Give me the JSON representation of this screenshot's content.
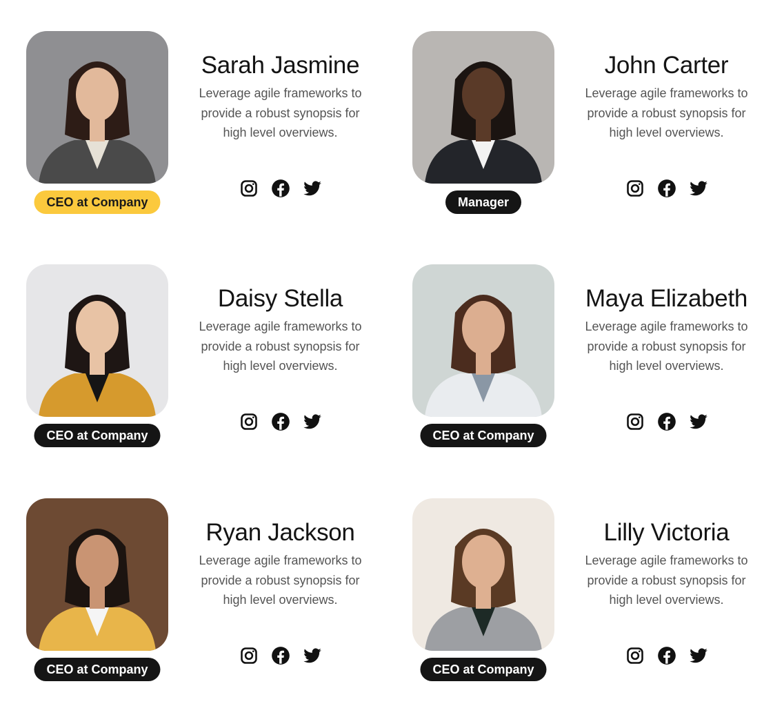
{
  "team": [
    {
      "name": "Sarah Jasmine",
      "role": "CEO at Company",
      "badge_style": "yellow",
      "desc": "Leverage agile frameworks to provide a robust synopsis for high level overviews.",
      "photo": {
        "bg": "#8f8f92",
        "skin": "#e2b99b",
        "hair": "#2d1c16",
        "outfit": "#4a4a4a",
        "shirt": "#e6e1d6"
      },
      "socials": [
        "instagram-icon",
        "facebook-icon",
        "twitter-icon"
      ]
    },
    {
      "name": "John Carter",
      "role": "Manager",
      "badge_style": "dark",
      "desc": "Leverage agile frameworks to provide a robust synopsis for high level overviews.",
      "photo": {
        "bg": "#b9b6b3",
        "skin": "#5a3a28",
        "hair": "#1b1411",
        "outfit": "#23252a",
        "shirt": "#f2f2f2"
      },
      "socials": [
        "instagram-icon",
        "facebook-icon",
        "twitter-icon"
      ]
    },
    {
      "name": "Daisy Stella",
      "role": "CEO at Company",
      "badge_style": "dark",
      "desc": "Leverage agile frameworks to provide a robust synopsis for high level overviews.",
      "photo": {
        "bg": "#e6e6e8",
        "skin": "#e8c3a5",
        "hair": "#1e1614",
        "outfit": "#d69a2d",
        "shirt": "#151515"
      },
      "socials": [
        "instagram-icon",
        "facebook-icon",
        "twitter-icon"
      ]
    },
    {
      "name": "Maya Elizabeth",
      "role": "CEO at Company",
      "badge_style": "dark",
      "desc": "Leverage agile frameworks to provide a robust synopsis for high level overviews.",
      "photo": {
        "bg": "#cfd6d4",
        "skin": "#dcae90",
        "hair": "#4b2c1e",
        "outfit": "#e9ecef",
        "shirt": "#8a97a5"
      },
      "socials": [
        "instagram-icon",
        "facebook-icon",
        "twitter-icon"
      ]
    },
    {
      "name": "Ryan Jackson",
      "role": "CEO at Company",
      "badge_style": "dark",
      "desc": "Leverage agile frameworks to provide a robust synopsis for high level overviews.",
      "photo": {
        "bg": "#6d4a33",
        "skin": "#c99473",
        "hair": "#1c1410",
        "outfit": "#e8b54a",
        "shirt": "#f5f5f5"
      },
      "socials": [
        "instagram-icon",
        "facebook-icon",
        "twitter-icon"
      ]
    },
    {
      "name": "Lilly Victoria",
      "role": "CEO at Company",
      "badge_style": "dark",
      "desc": "Leverage agile frameworks to provide a robust synopsis for high level overviews.",
      "photo": {
        "bg": "#efe9e2",
        "skin": "#deb091",
        "hair": "#5a3a24",
        "outfit": "#9d9fa3",
        "shirt": "#1d2a26"
      },
      "socials": [
        "instagram-icon",
        "facebook-icon",
        "twitter-icon"
      ]
    }
  ]
}
